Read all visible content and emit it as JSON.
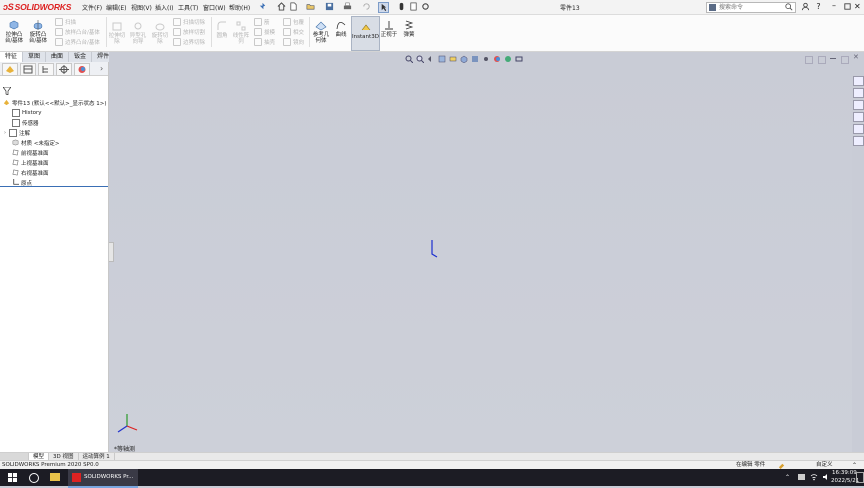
{
  "app": {
    "name": "SOLIDWORKS",
    "doc_title": "零件13"
  },
  "menu": [
    "文件(F)",
    "编辑(E)",
    "视图(V)",
    "插入(I)",
    "工具(T)",
    "窗口(W)",
    "帮助(H)"
  ],
  "search": {
    "placeholder": "搜索命令"
  },
  "ribbon": {
    "main": [
      {
        "label1": "拉伸凸",
        "label2": "台/基体"
      },
      {
        "label1": "旋转凸",
        "label2": "台/基体"
      }
    ],
    "side_small": [
      "扫描",
      "放样凸台/基体",
      "边界凸台/基体"
    ],
    "disabled_large": [
      {
        "label1": "拉伸切",
        "label2": "除"
      },
      {
        "label1": "异型孔",
        "label2": "向导"
      },
      {
        "label1": "旋转切",
        "label2": "除"
      }
    ],
    "cut_small": [
      "扫描切除",
      "放样切割",
      "边界切除"
    ],
    "disabled_large2": [
      {
        "label1": "圆角",
        "label2": ""
      },
      {
        "label1": "线性阵",
        "label2": "列"
      }
    ],
    "feat_small": [
      "筋",
      "拔模",
      "抽壳",
      "包覆",
      "相交",
      "镜向"
    ],
    "right": [
      {
        "label1": "参考几",
        "label2": "何体"
      },
      {
        "label1": "曲线",
        "label2": ""
      },
      {
        "label1": "Instant3D",
        "label2": ""
      },
      {
        "label1": "正视于",
        "label2": ""
      },
      {
        "label1": "弹簧",
        "label2": ""
      }
    ]
  },
  "command_tabs": [
    "特征",
    "草图",
    "曲面",
    "钣金",
    "焊件",
    "评估"
  ],
  "tree": {
    "root": "零件13 (默认<<默认>_显示状态 1>)",
    "items": [
      "History",
      "传感器",
      "注解",
      "材质 <未指定>",
      "前视基准面",
      "上视基准面",
      "右视基准面",
      "原点"
    ]
  },
  "view_label": "*等轴测",
  "bottom_tabs": [
    "模型",
    "3D 视图",
    "运动算例 1"
  ],
  "status": {
    "left": "SOLIDWORKS Premium 2020 SP0.0",
    "mode": "在编辑 零件",
    "units": "自定义"
  },
  "taskbar": {
    "app_label": "SOLIDWORKS Pr...",
    "time": "16:39:09",
    "date": "2022/5/21"
  },
  "colors": {
    "accent": "#d22222",
    "viewport": "#c9ccd6",
    "taskbar": "#1c1c24"
  }
}
